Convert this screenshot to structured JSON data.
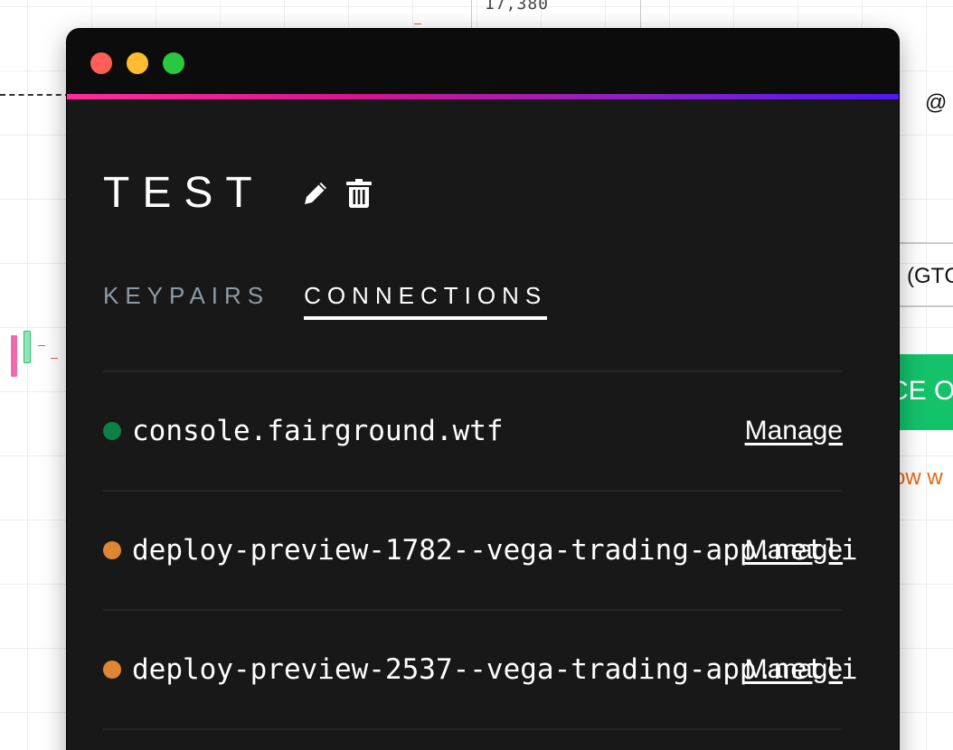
{
  "background": {
    "price_label": "17,380",
    "at_symbol": "@",
    "select_value": "(GTC",
    "button_label": "CE O",
    "warning_text": "ow w"
  },
  "wallet": {
    "name": "TEST",
    "accent_gradient": [
      "#ff2d9b",
      "#d4148f",
      "#8a1fc7",
      "#4f18f0"
    ],
    "tabs": [
      {
        "label": "KEYPAIRS",
        "active": false
      },
      {
        "label": "CONNECTIONS",
        "active": true
      }
    ],
    "connections": [
      {
        "hostname": "console.fairground.wtf",
        "status_color": "#0d8043",
        "action_label": "Manage"
      },
      {
        "hostname": "deploy-preview-1782--vega-trading-app.netli",
        "status_color": "#df8634",
        "action_label": "Manage"
      },
      {
        "hostname": "deploy-preview-2537--vega-trading-app.netli",
        "status_color": "#df8634",
        "action_label": "Manage"
      }
    ]
  }
}
